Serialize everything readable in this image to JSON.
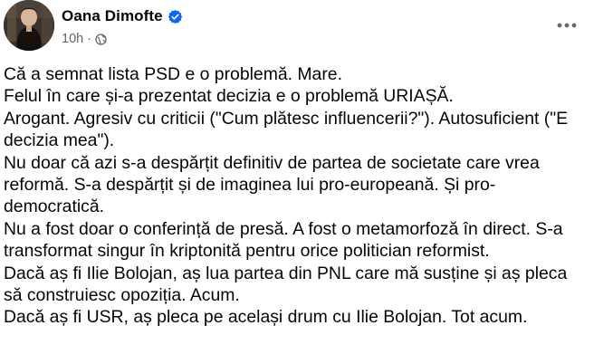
{
  "post": {
    "author": {
      "name": "Oana Dimofte",
      "verified": true,
      "avatar_icon": "profile-photo"
    },
    "meta": {
      "time": "10h",
      "separator": "·",
      "audience_icon": "globe-icon"
    },
    "more_icon": "more-horizontal-icon",
    "colors": {
      "text": "#050505",
      "secondary": "#65676b",
      "verified_badge": "#0866ff"
    },
    "paragraphs": [
      "Că a semnat lista PSD e o problemă. Mare.",
      "Felul în care și-a prezentat decizia e o problemă URIAȘĂ.",
      "Arogant. Agresiv cu criticii (\"Cum plătesc influencerii?\"). Autosuficient (\"E decizia mea\").",
      "Nu doar că azi s-a despărțit definitiv de partea de societate care vrea reformă. S-a despărțit și de imaginea lui pro-europeană. Și pro-democratică.",
      "Nu a fost doar o conferință de presă. A fost o metamorfoză în direct. S-a transformat singur în kriptonită pentru orice politician reformist.",
      "Dacă aș fi Ilie Bolojan, aș lua partea din PNL care mă susține și aș pleca să construiesc opoziția. Acum.",
      "Dacă aș fi USR, aș pleca pe același drum cu Ilie Bolojan. Tot acum."
    ]
  }
}
